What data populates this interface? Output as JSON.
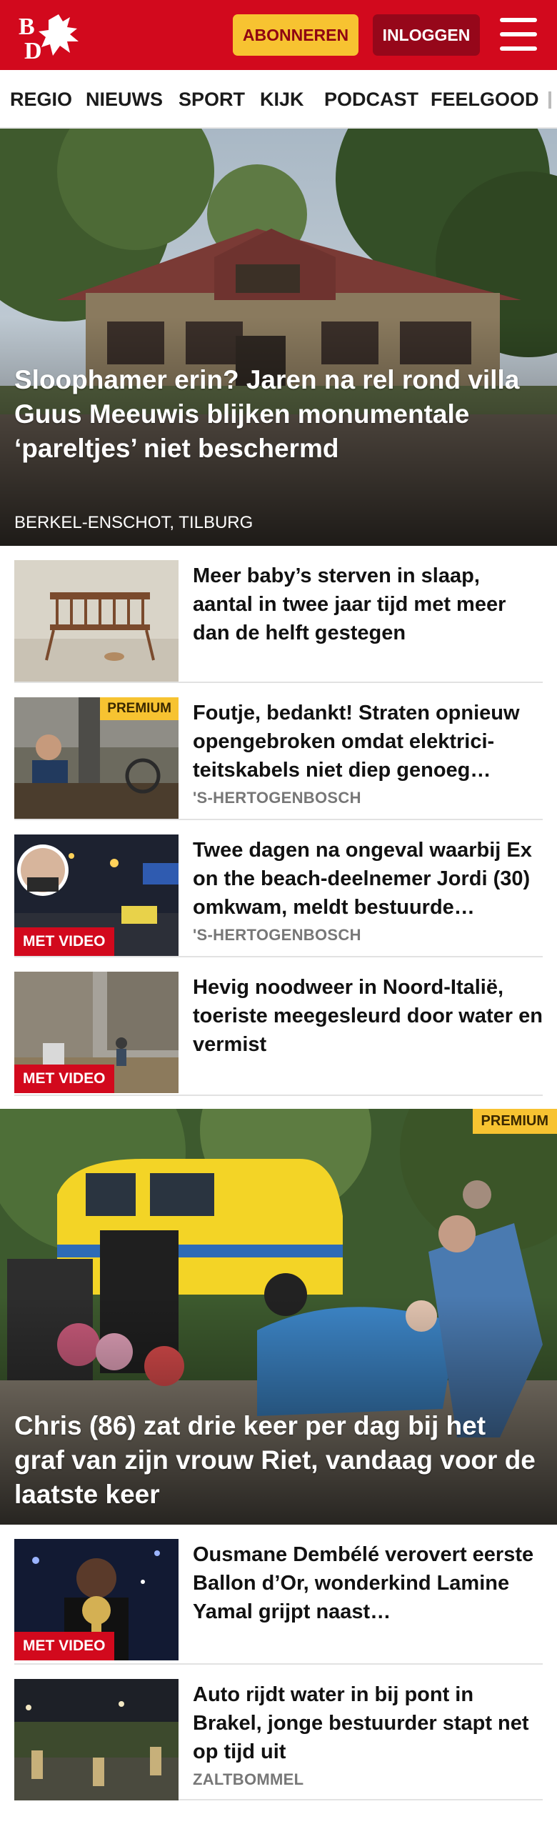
{
  "header": {
    "logo_text": "BD",
    "subscribe_label": "ABONNEREN",
    "login_label": "INLOGGEN",
    "brand_red": "#d2091d",
    "accent_yellow": "#f7c331"
  },
  "nav": {
    "items": [
      "REGIO",
      "NIEUWS",
      "SPORT",
      "KIJK",
      "PODCAST",
      "FEELGOOD"
    ]
  },
  "hero": {
    "title": "Sloophamer erin? Jaren na rel rond villa Guus Meeuwis blijken monumentale ‘pareltjes’ niet beschermd",
    "location": "BERKEL-ENSCHOT, TILBURG"
  },
  "articles": [
    {
      "title": "Meer baby’s sterven in slaap, aantal in twee jaar tijd met meer dan de helft gestegen",
      "location": "",
      "badge": ""
    },
    {
      "title": "Foutje, bedankt! Straten opnieuw opengebroken omdat elektrici­teitskabels niet diep genoeg…",
      "location": "'S-HERTOGENBOSCH",
      "badge": "PREMIUM"
    },
    {
      "title": "Twee dagen na ongeval waarbij Ex on the beach-deelnemer Jordi (30) omkwam, meldt bestuurde…",
      "location": "'S-HERTOGENBOSCH",
      "badge": "MET VIDEO"
    },
    {
      "title": "Hevig noodweer in Noord-Italië, toeriste meegesleurd door water en vermist",
      "location": "",
      "badge": "MET VIDEO"
    }
  ],
  "feature": {
    "title": "Chris (86) zat drie keer per dag bij het graf van zijn vrouw Riet, vandaag voor de laatste keer",
    "badge": "PREMIUM"
  },
  "articles2": [
    {
      "title": "Ousmane Dembélé verovert eerste Ballon d’Or, wonderkind Lamine Yamal grijpt naast…",
      "location": "",
      "badge": "MET VIDEO"
    },
    {
      "title": "Auto rijdt water in bij pont in Brakel, jonge bestuurder stapt net op tijd uit",
      "location": "ZALTBOMMEL",
      "badge": ""
    }
  ]
}
